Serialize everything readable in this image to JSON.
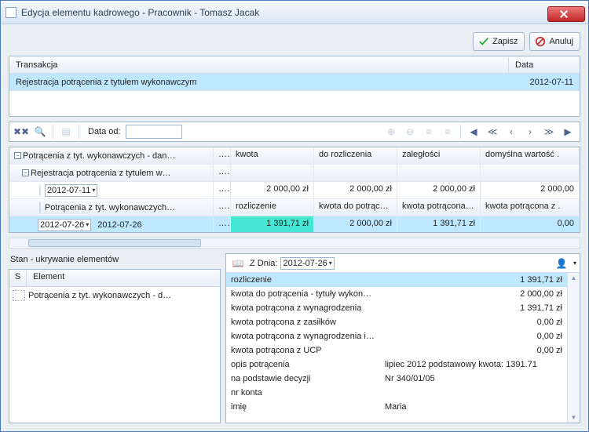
{
  "window": {
    "title": "Edycja elementu kadrowego - Pracownik - Tomasz Jacak"
  },
  "actions": {
    "save_label": "Zapisz",
    "cancel_label": "Anuluj"
  },
  "trans": {
    "header_trans": "Transakcja",
    "header_date": "Data",
    "row": {
      "text": "Rejestracja potrącenia z tytułem wykonawczym",
      "date": "2012-07-11"
    }
  },
  "toolbar": {
    "date_label": "Data od:",
    "date_value": ""
  },
  "tree_grid": {
    "header": {
      "c1": "kwota",
      "c2": "do rozliczenia",
      "c3": "zaległości",
      "c4": "domyślna wartość ."
    },
    "r0": "Potrącenia z tyt. wykonawczych - dan…",
    "r1": "Rejestracja potrącenia z tytułem w…",
    "r2": {
      "date": "2012-07-11",
      "kwota": "2 000,00 zł",
      "rozl": "2 000,00 zł",
      "zagl": "2 000,00 zł",
      "dom": "2 000,00"
    },
    "r3": {
      "label": "Potrącenia z tyt. wykonawczych…",
      "c1": "rozliczenie",
      "c2": "kwota do potrąceni…",
      "c3": "kwota potrącona z …",
      "c4": "kwota potrącona z ."
    },
    "r4": {
      "date1": "2012-07-26",
      "date2": "2012-07-26",
      "kwota": "1 391,71 zł",
      "rozl": "2 000,00 zł",
      "zagl": "1 391,71 zł",
      "dom": "0,00"
    }
  },
  "stan": {
    "title": "Stan - ukrywanie elementów",
    "head_s": "S",
    "head_el": "Element",
    "row": "Potrącenia z tyt. wykonawczych - d…"
  },
  "detail": {
    "zdnia_label": "Z Dnia:",
    "zdnia_value": "2012-07-26",
    "rows": [
      {
        "k": "rozliczenie",
        "v": "1 391,71 zł",
        "sel": true,
        "align": "right"
      },
      {
        "k": "kwota do potrącenia - tytuły wykon…",
        "v": "2 000,00 zł",
        "align": "right"
      },
      {
        "k": "kwota potrącona z wynagrodzenia",
        "v": "1 391,71 zł",
        "align": "right"
      },
      {
        "k": "kwota potrącona z zasiłków",
        "v": "0,00 zł",
        "align": "right"
      },
      {
        "k": "kwota potrącona z wynagrodzenia i…",
        "v": "0,00 zł",
        "align": "right"
      },
      {
        "k": "kwota potrącona z UCP",
        "v": "0,00 zł",
        "align": "right"
      },
      {
        "k": "opis potrącenia",
        "v": "lipiec 2012 podstawowy kwota: 1391.71",
        "align": "left"
      },
      {
        "k": "na podstawie decyzji",
        "v": "Nr 340/01/05",
        "align": "left"
      },
      {
        "k": "nr konta",
        "v": "",
        "align": "left"
      },
      {
        "k": "imię",
        "v": "Maria",
        "align": "left"
      }
    ]
  }
}
